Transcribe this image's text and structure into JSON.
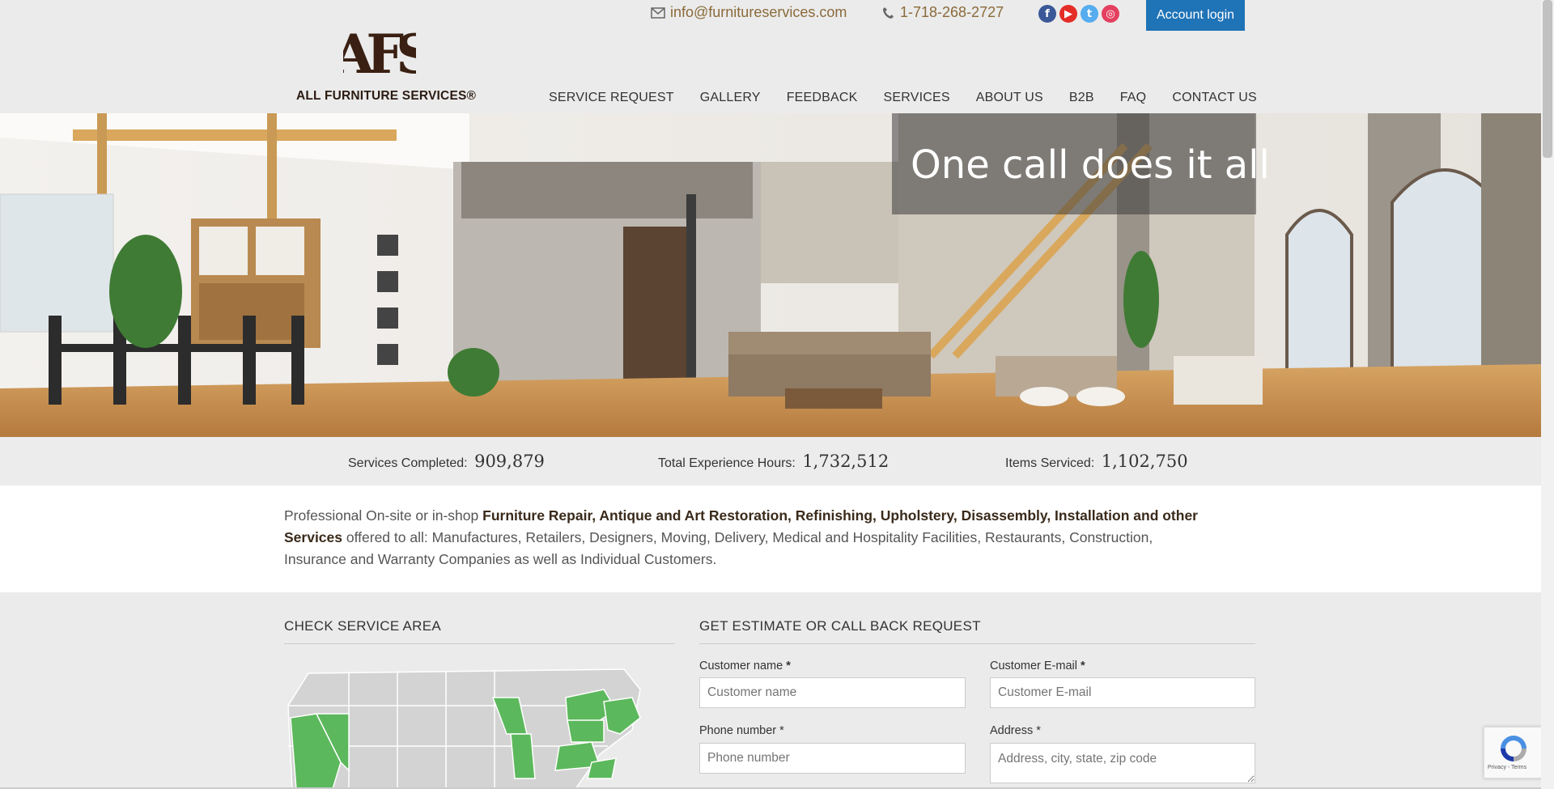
{
  "header": {
    "logo_text": "ALL FURNITURE SERVICES®",
    "logo_monogram": "AFS",
    "email": "info@furnitureservices.com",
    "phone": "1-718-268-2727",
    "account_login": "Account login",
    "social_icons": [
      "facebook-icon",
      "youtube-icon",
      "twitter-icon",
      "instagram-icon"
    ]
  },
  "nav": {
    "items": [
      {
        "label": "SERVICE REQUEST"
      },
      {
        "label": "GALLERY"
      },
      {
        "label": "FEEDBACK"
      },
      {
        "label": "SERVICES"
      },
      {
        "label": "ABOUT US"
      },
      {
        "label": "B2B"
      },
      {
        "label": "FAQ"
      },
      {
        "label": "CONTACT US"
      }
    ]
  },
  "hero": {
    "title": "One call does it all"
  },
  "stats": [
    {
      "label": "Services Completed:",
      "value": "909,879"
    },
    {
      "label": "Total Experience Hours:",
      "value": "1,732,512"
    },
    {
      "label": "Items Serviced:",
      "value": "1,102,750"
    }
  ],
  "intro": {
    "lead": "Professional On-site or in-shop ",
    "bold": "Furniture Repair, Antique and Art Restoration, Refinishing, Upholstery, Disassembly, Installation and other Services",
    "rest": " offered to all: Manufactures, Retailers, Designers, Moving, Delivery, Medical and Hospitality Facilities, Restaurants, Construction, Insurance and Warranty Companies as well as Individual Customers."
  },
  "service_area": {
    "title": "CHECK SERVICE AREA",
    "highlight_color": "#5cb85c",
    "base_color": "#d3d3d3"
  },
  "estimate_form": {
    "title": "GET ESTIMATE OR CALL BACK REQUEST",
    "fields": [
      {
        "label": "Customer name",
        "required_mark": "*",
        "placeholder": "Customer name"
      },
      {
        "label": "Customer E-mail",
        "required_mark": "*",
        "placeholder": "Customer E-mail"
      },
      {
        "label": "Phone number *",
        "required_mark": "",
        "placeholder": "Phone number"
      },
      {
        "label": "Address *",
        "required_mark": "",
        "placeholder": "Address, city, state, zip code"
      }
    ]
  },
  "recaptcha": {
    "links": "Privacy - Terms"
  },
  "colors": {
    "accent_blue": "#1f73b7",
    "brown": "#3a2a1a",
    "gold_link": "#8a6a3a"
  }
}
